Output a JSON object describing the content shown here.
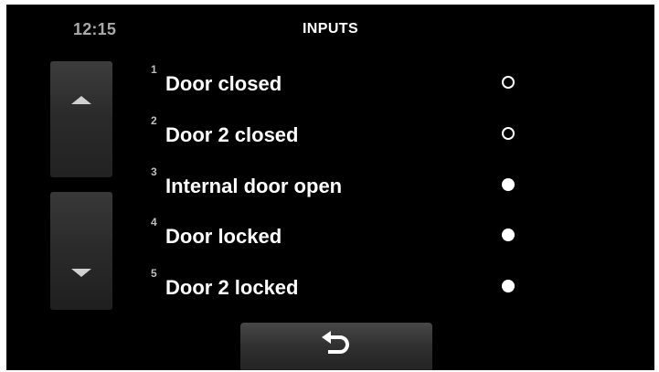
{
  "header": {
    "clock": "12:15",
    "title": "INPUTS"
  },
  "scroll": {
    "up_icon": "triangle-up-icon",
    "down_icon": "triangle-down-icon"
  },
  "inputs": [
    {
      "num": "1",
      "label": "Door closed",
      "state": "off"
    },
    {
      "num": "2",
      "label": "Door 2 closed",
      "state": "off"
    },
    {
      "num": "3",
      "label": "Internal door open",
      "state": "on"
    },
    {
      "num": "4",
      "label": "Door locked",
      "state": "on"
    },
    {
      "num": "5",
      "label": "Door 2 locked",
      "state": "on"
    }
  ],
  "footer": {
    "back_icon": "return-arrow-icon"
  },
  "colors": {
    "screen_bg": "#000000",
    "text": "#ffffff",
    "clock": "#a9a9a9",
    "button": "#2e2e2e"
  }
}
